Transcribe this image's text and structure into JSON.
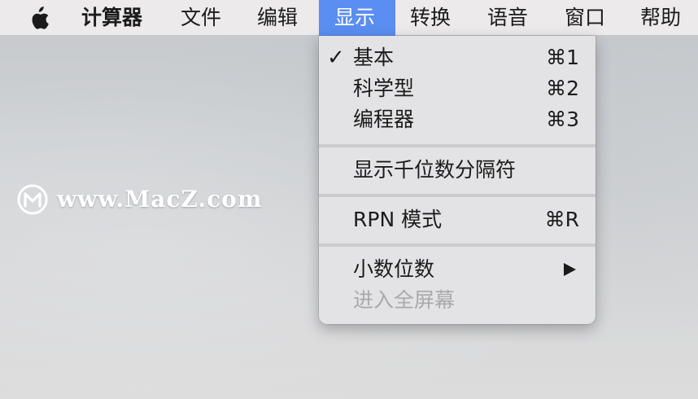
{
  "menubar": {
    "apple_icon": "apple-logo-icon",
    "items": [
      {
        "label": "计算器"
      },
      {
        "label": "文件"
      },
      {
        "label": "编辑"
      },
      {
        "label": "显示"
      },
      {
        "label": "转换"
      },
      {
        "label": "语音"
      },
      {
        "label": "窗口"
      },
      {
        "label": "帮助"
      }
    ],
    "active_color": "#5a8ef1"
  },
  "dropdown": {
    "items": [
      {
        "check": "✓",
        "label": "基本",
        "shortcut": "⌘1"
      },
      {
        "label": "科学型",
        "shortcut": "⌘2"
      },
      {
        "label": "编程器",
        "shortcut": "⌘3"
      },
      {
        "label": "显示千位数分隔符"
      },
      {
        "label": "RPN 模式",
        "shortcut": "⌘R"
      },
      {
        "label": "小数位数",
        "submenu_icon": "triangle-right-icon"
      },
      {
        "label": "进入全屏幕",
        "disabled": true
      }
    ]
  },
  "watermark": {
    "logo_icon": "macz-logo-icon",
    "text": "www.MacZ.com"
  }
}
